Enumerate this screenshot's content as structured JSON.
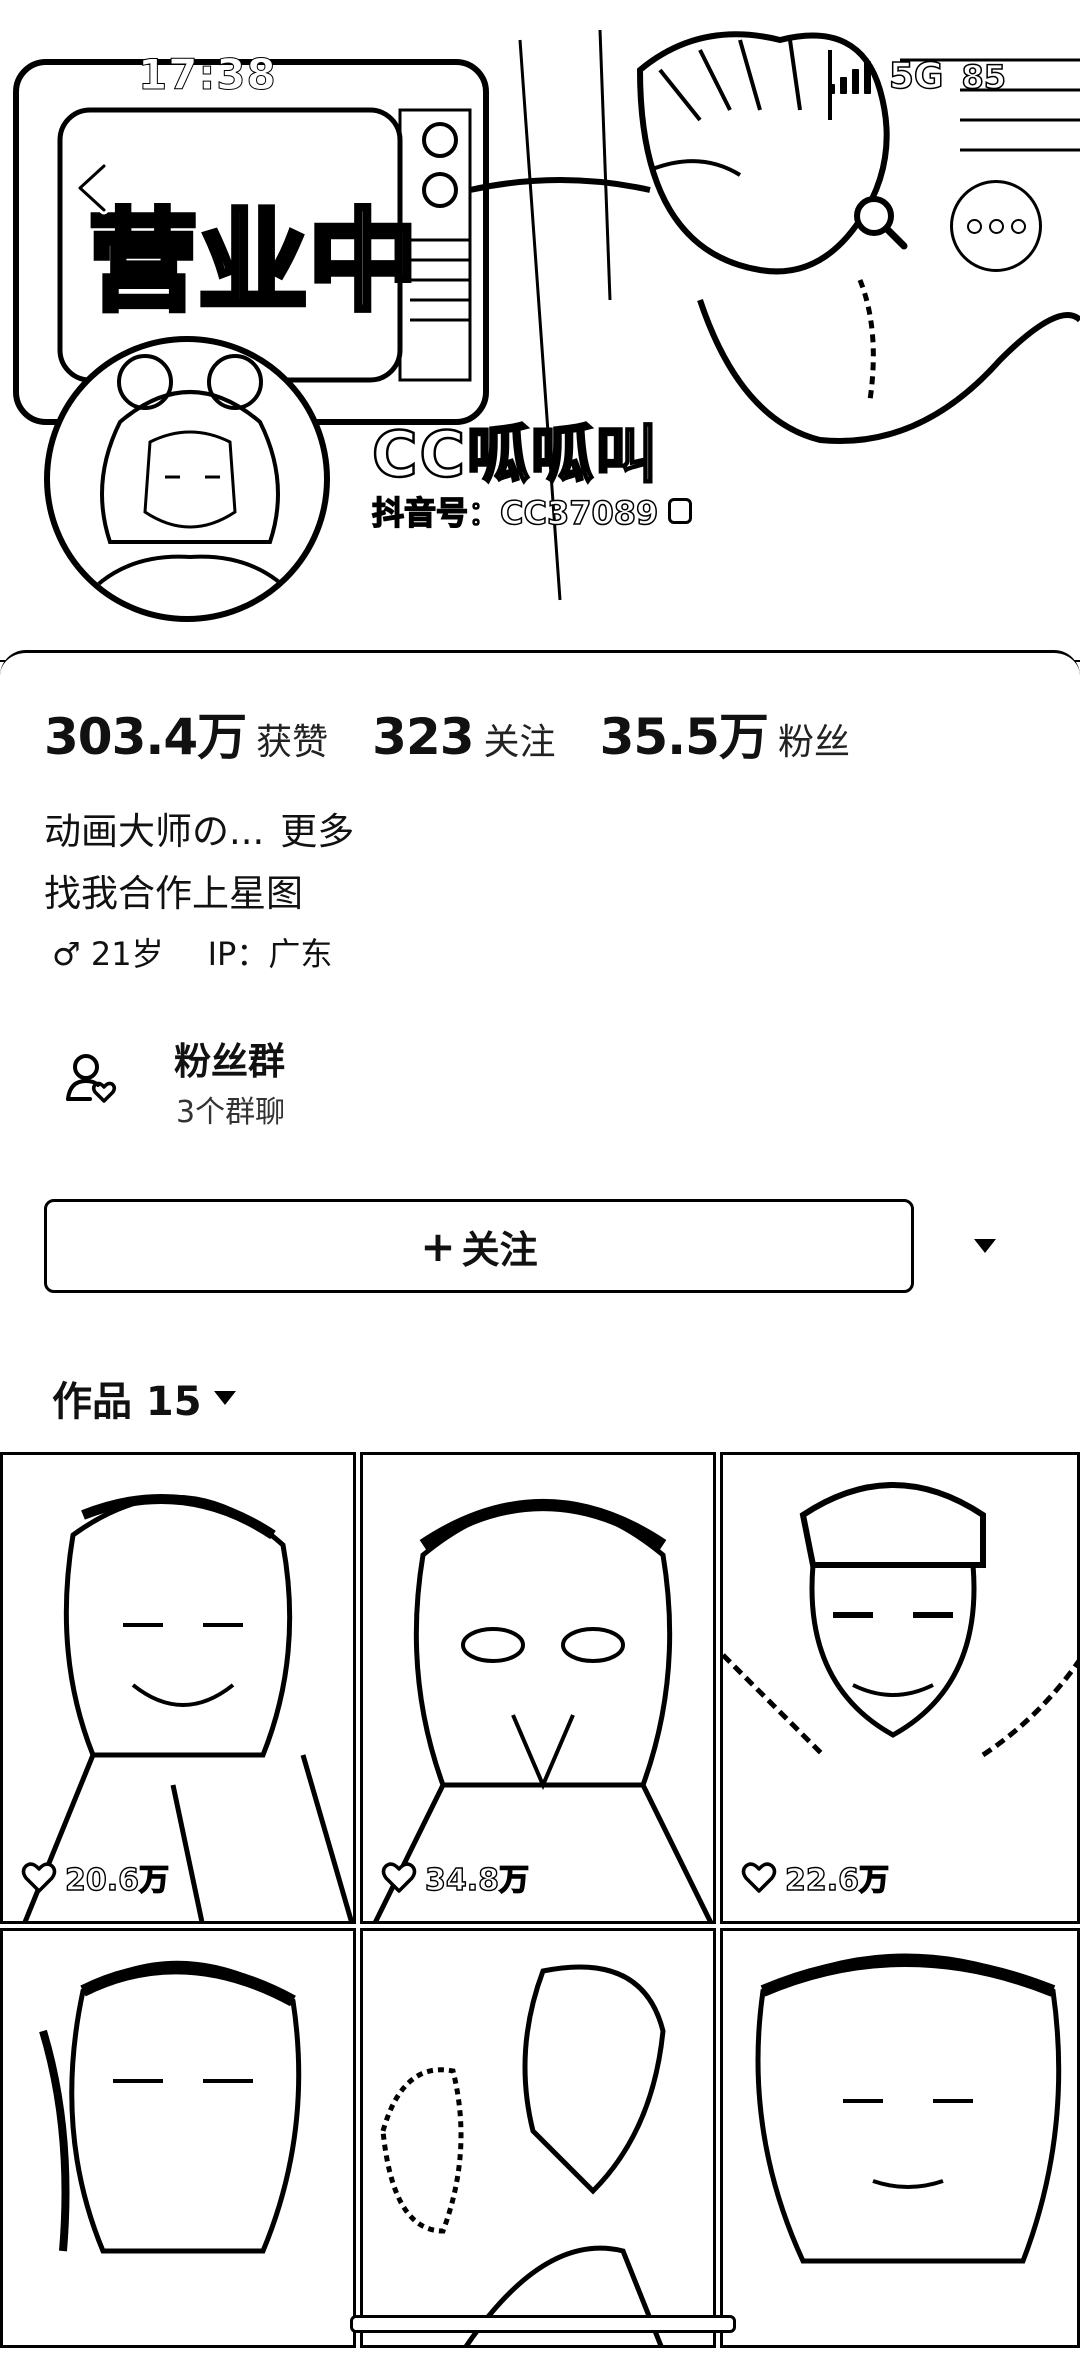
{
  "status_bar": {
    "time": "17:38",
    "network": "5G",
    "battery": "85"
  },
  "header": {
    "banner_text": "营业中",
    "nickname": "CC呱呱叫",
    "douyin_id": "抖音号：CC37089"
  },
  "stats": [
    {
      "value": "303.4万",
      "label": "获赞"
    },
    {
      "value": "323",
      "label": "关注"
    },
    {
      "value": "35.5万",
      "label": "粉丝"
    }
  ],
  "bio": {
    "line1": "动画大师の...",
    "more": "更多",
    "line2": "找我合作上星图",
    "gender_age": "♂ 21岁",
    "ip": "IP：广东"
  },
  "fan_group": {
    "title": "粉丝群",
    "subtitle": "3个群聊"
  },
  "follow": {
    "label": "关注",
    "plus": "+"
  },
  "works_tab": {
    "label": "作品 15"
  },
  "videos": [
    {
      "likes": "20.6万"
    },
    {
      "likes": "34.8万"
    },
    {
      "likes": "22.6万"
    },
    {
      "likes": ""
    },
    {
      "likes": ""
    },
    {
      "likes": ""
    }
  ],
  "icons": {
    "back": "chevron-left-icon",
    "search": "search-icon",
    "more": "more-icon",
    "fan_group": "people-heart-icon",
    "heart": "heart-icon",
    "dropdown": "triangle-down-icon"
  }
}
